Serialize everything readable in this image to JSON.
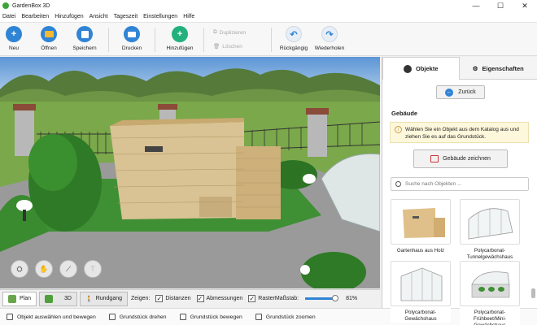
{
  "window": {
    "title": "GardenBox 3D",
    "min": "—",
    "max": "☐",
    "close": "✕"
  },
  "menu": [
    "Datei",
    "Bearbeiten",
    "Hinzufügen",
    "Ansicht",
    "Tageszeit",
    "Einstellungen",
    "Hilfe"
  ],
  "toolbar": {
    "new": "Neu",
    "open": "Öffnen",
    "save": "Speichern",
    "print": "Drucken",
    "add": "Hinzufügen",
    "duplicate": "Duplizieren",
    "delete": "Löschen",
    "undo": "Rückgängig",
    "redo": "Wiederholen"
  },
  "viewbar": {
    "plan": "Plan",
    "three_d": "3D",
    "walk": "Rundgang",
    "show_label": "Zeigen:",
    "distances": "Distanzen",
    "dimensions": "Abmessungen",
    "grid": "Raster",
    "scale_label": "Maßstab:",
    "zoom": "81%"
  },
  "status": [
    "Objekt auswählen und bewegen",
    "Grundstück drehen",
    "Grundstück bewegen",
    "Grundstück zoomen"
  ],
  "panel": {
    "tab_objects": "Objekte",
    "tab_properties": "Eigenschaften",
    "back": "Zurück",
    "section": "Gebäude",
    "info": "Wählen Sie ein Objekt aus dem Katalog aus und ziehen Sie es auf das Grundstück.",
    "draw": "Gebäude zeichnen",
    "search_placeholder": "Suche nach Objekten ...",
    "items": [
      "Gartenhaus aus Holz",
      "Polycarbonat-Tunnelgewächshaus",
      "Polycarbonat-Gewächshaus",
      "Polycarbonat-Frühbeet/Mini-Gewächshaus"
    ]
  },
  "colors": {
    "accent": "#2f84d6",
    "add_green": "#22b07d"
  }
}
